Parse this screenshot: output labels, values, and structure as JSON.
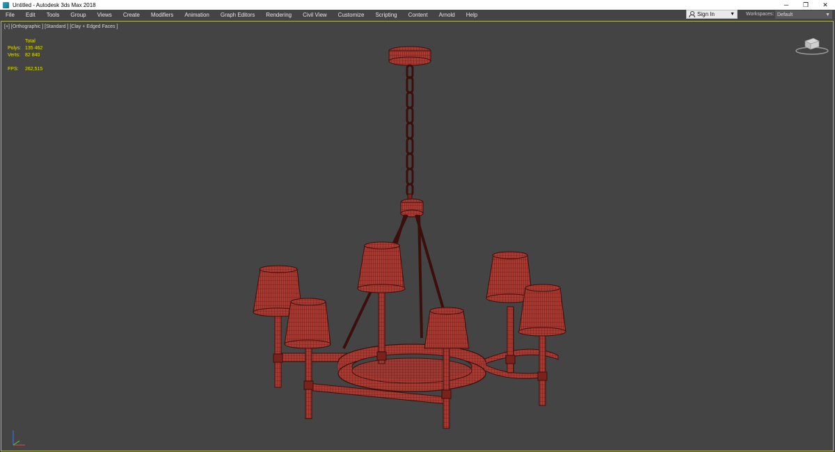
{
  "window": {
    "title": "Untitled - Autodesk 3ds Max 2018",
    "controls": {
      "minimize": "─",
      "restore": "❐",
      "close": "✕"
    }
  },
  "menubar": {
    "items": [
      "File",
      "Edit",
      "Tools",
      "Group",
      "Views",
      "Create",
      "Modifiers",
      "Animation",
      "Graph Editors",
      "Rendering",
      "Civil View",
      "Customize",
      "Scripting",
      "Content",
      "Arnold",
      "Help"
    ]
  },
  "account": {
    "sign_in_label": "Sign In",
    "icon": "user-icon"
  },
  "workspaces": {
    "label": "Workspaces:",
    "selected": "Default"
  },
  "viewport": {
    "label": "[+] [Orthographic ] [Standard ] [Clay + Edged Faces ]",
    "stats": {
      "header": "Total",
      "polys_label": "Polys:",
      "polys_value": "135 462",
      "verts_label": "Verts:",
      "verts_value": "82 840",
      "fps_label": "FPS:",
      "fps_value": "262,515"
    },
    "border_color": "#b6b65a",
    "model_color": "#a83a32",
    "wire_color": "#3a0f0c"
  }
}
